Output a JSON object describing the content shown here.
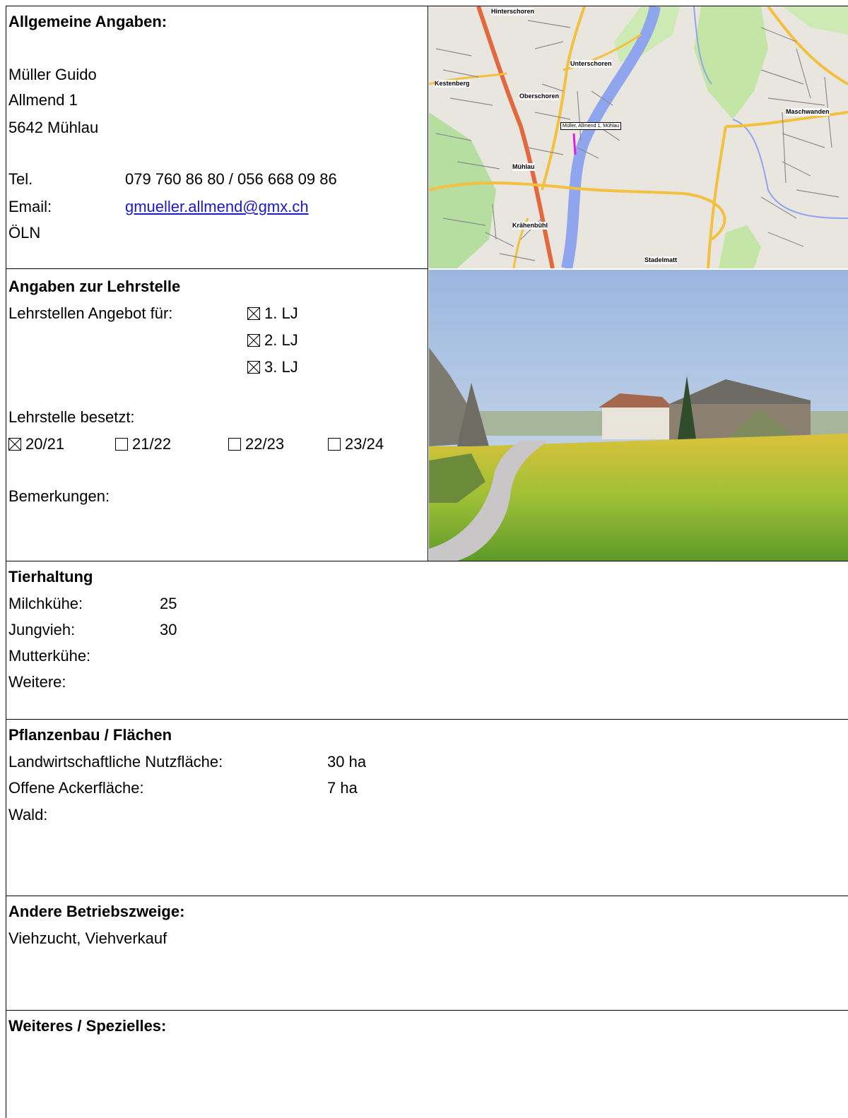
{
  "general": {
    "heading": "Allgemeine Angaben:",
    "name": "Müller Guido",
    "street": "Allmend 1",
    "city": "5642 Mühlau",
    "tel_label": "Tel.",
    "tel_value": "079 760 86 80 / 056 668 09 86",
    "email_label": "Email:",
    "email_value": "gmueller.allmend@gmx.ch",
    "certification": "ÖLN"
  },
  "map": {
    "labels": [
      "Hinterschoren",
      "Unterschoren",
      "Kestenberg",
      "Oberschoren",
      "Maschwanden",
      "Müller, Allmend 1, Mühlau",
      "Mühlau",
      "Krähenbühl",
      "Stadelmatt"
    ]
  },
  "apprenticeship": {
    "heading": "Angaben zur Lehrstelle",
    "offer_label": "Lehrstellen Angebot für:",
    "years": [
      {
        "label": "1. LJ",
        "checked": true
      },
      {
        "label": "2. LJ",
        "checked": true
      },
      {
        "label": "3. LJ",
        "checked": true
      }
    ],
    "occupied_label": "Lehrstelle besetzt:",
    "occupied": [
      {
        "label": "20/21",
        "checked": true
      },
      {
        "label": "21/22",
        "checked": false
      },
      {
        "label": "22/23",
        "checked": false
      },
      {
        "label": "23/24",
        "checked": false
      }
    ],
    "remarks_label": "Bemerkungen:"
  },
  "livestock": {
    "heading": "Tierhaltung",
    "rows": [
      {
        "label": "Milchkühe:",
        "value": "25"
      },
      {
        "label": "Jungvieh:",
        "value": "30"
      },
      {
        "label": "Mutterkühe:",
        "value": ""
      },
      {
        "label": "Weitere:",
        "value": ""
      }
    ]
  },
  "crops": {
    "heading": "Pflanzenbau / Flächen",
    "rows": [
      {
        "label": "Landwirtschaftliche Nutzfläche:",
        "value": "30 ha"
      },
      {
        "label": "Offene Ackerfläche:",
        "value": "7 ha"
      },
      {
        "label": "Wald:",
        "value": ""
      }
    ]
  },
  "branches": {
    "heading": "Andere Betriebszweige:",
    "text": "Viehzucht, Viehverkauf"
  },
  "other": {
    "heading": "Weiteres / Spezielles:"
  }
}
